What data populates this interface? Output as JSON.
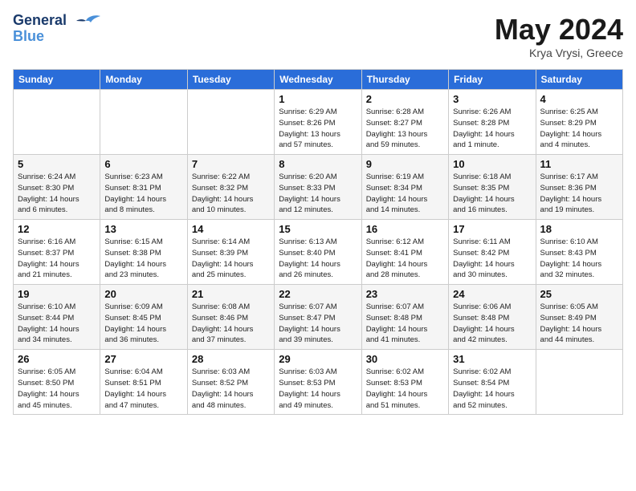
{
  "header": {
    "logo_line1": "General",
    "logo_line2": "Blue",
    "month": "May 2024",
    "location": "Krya Vrysi, Greece"
  },
  "days_of_week": [
    "Sunday",
    "Monday",
    "Tuesday",
    "Wednesday",
    "Thursday",
    "Friday",
    "Saturday"
  ],
  "weeks": [
    [
      {
        "day": "",
        "info": ""
      },
      {
        "day": "",
        "info": ""
      },
      {
        "day": "",
        "info": ""
      },
      {
        "day": "1",
        "info": "Sunrise: 6:29 AM\nSunset: 8:26 PM\nDaylight: 13 hours\nand 57 minutes."
      },
      {
        "day": "2",
        "info": "Sunrise: 6:28 AM\nSunset: 8:27 PM\nDaylight: 13 hours\nand 59 minutes."
      },
      {
        "day": "3",
        "info": "Sunrise: 6:26 AM\nSunset: 8:28 PM\nDaylight: 14 hours\nand 1 minute."
      },
      {
        "day": "4",
        "info": "Sunrise: 6:25 AM\nSunset: 8:29 PM\nDaylight: 14 hours\nand 4 minutes."
      }
    ],
    [
      {
        "day": "5",
        "info": "Sunrise: 6:24 AM\nSunset: 8:30 PM\nDaylight: 14 hours\nand 6 minutes."
      },
      {
        "day": "6",
        "info": "Sunrise: 6:23 AM\nSunset: 8:31 PM\nDaylight: 14 hours\nand 8 minutes."
      },
      {
        "day": "7",
        "info": "Sunrise: 6:22 AM\nSunset: 8:32 PM\nDaylight: 14 hours\nand 10 minutes."
      },
      {
        "day": "8",
        "info": "Sunrise: 6:20 AM\nSunset: 8:33 PM\nDaylight: 14 hours\nand 12 minutes."
      },
      {
        "day": "9",
        "info": "Sunrise: 6:19 AM\nSunset: 8:34 PM\nDaylight: 14 hours\nand 14 minutes."
      },
      {
        "day": "10",
        "info": "Sunrise: 6:18 AM\nSunset: 8:35 PM\nDaylight: 14 hours\nand 16 minutes."
      },
      {
        "day": "11",
        "info": "Sunrise: 6:17 AM\nSunset: 8:36 PM\nDaylight: 14 hours\nand 19 minutes."
      }
    ],
    [
      {
        "day": "12",
        "info": "Sunrise: 6:16 AM\nSunset: 8:37 PM\nDaylight: 14 hours\nand 21 minutes."
      },
      {
        "day": "13",
        "info": "Sunrise: 6:15 AM\nSunset: 8:38 PM\nDaylight: 14 hours\nand 23 minutes."
      },
      {
        "day": "14",
        "info": "Sunrise: 6:14 AM\nSunset: 8:39 PM\nDaylight: 14 hours\nand 25 minutes."
      },
      {
        "day": "15",
        "info": "Sunrise: 6:13 AM\nSunset: 8:40 PM\nDaylight: 14 hours\nand 26 minutes."
      },
      {
        "day": "16",
        "info": "Sunrise: 6:12 AM\nSunset: 8:41 PM\nDaylight: 14 hours\nand 28 minutes."
      },
      {
        "day": "17",
        "info": "Sunrise: 6:11 AM\nSunset: 8:42 PM\nDaylight: 14 hours\nand 30 minutes."
      },
      {
        "day": "18",
        "info": "Sunrise: 6:10 AM\nSunset: 8:43 PM\nDaylight: 14 hours\nand 32 minutes."
      }
    ],
    [
      {
        "day": "19",
        "info": "Sunrise: 6:10 AM\nSunset: 8:44 PM\nDaylight: 14 hours\nand 34 minutes."
      },
      {
        "day": "20",
        "info": "Sunrise: 6:09 AM\nSunset: 8:45 PM\nDaylight: 14 hours\nand 36 minutes."
      },
      {
        "day": "21",
        "info": "Sunrise: 6:08 AM\nSunset: 8:46 PM\nDaylight: 14 hours\nand 37 minutes."
      },
      {
        "day": "22",
        "info": "Sunrise: 6:07 AM\nSunset: 8:47 PM\nDaylight: 14 hours\nand 39 minutes."
      },
      {
        "day": "23",
        "info": "Sunrise: 6:07 AM\nSunset: 8:48 PM\nDaylight: 14 hours\nand 41 minutes."
      },
      {
        "day": "24",
        "info": "Sunrise: 6:06 AM\nSunset: 8:48 PM\nDaylight: 14 hours\nand 42 minutes."
      },
      {
        "day": "25",
        "info": "Sunrise: 6:05 AM\nSunset: 8:49 PM\nDaylight: 14 hours\nand 44 minutes."
      }
    ],
    [
      {
        "day": "26",
        "info": "Sunrise: 6:05 AM\nSunset: 8:50 PM\nDaylight: 14 hours\nand 45 minutes."
      },
      {
        "day": "27",
        "info": "Sunrise: 6:04 AM\nSunset: 8:51 PM\nDaylight: 14 hours\nand 47 minutes."
      },
      {
        "day": "28",
        "info": "Sunrise: 6:03 AM\nSunset: 8:52 PM\nDaylight: 14 hours\nand 48 minutes."
      },
      {
        "day": "29",
        "info": "Sunrise: 6:03 AM\nSunset: 8:53 PM\nDaylight: 14 hours\nand 49 minutes."
      },
      {
        "day": "30",
        "info": "Sunrise: 6:02 AM\nSunset: 8:53 PM\nDaylight: 14 hours\nand 51 minutes."
      },
      {
        "day": "31",
        "info": "Sunrise: 6:02 AM\nSunset: 8:54 PM\nDaylight: 14 hours\nand 52 minutes."
      },
      {
        "day": "",
        "info": ""
      }
    ]
  ]
}
